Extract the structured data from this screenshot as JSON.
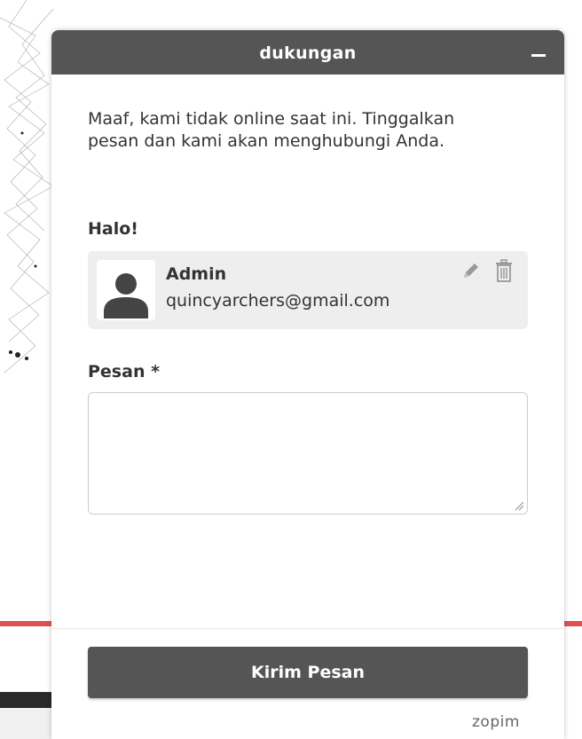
{
  "header": {
    "title": "dukungan",
    "minimize_icon": "minus-icon"
  },
  "offline_message": "Maaf, kami tidak online saat ini. Tinggalkan pesan dan kami akan menghubungi Anda.",
  "greeting": "Halo!",
  "profile": {
    "name": "Admin",
    "email": "quincyarchers@gmail.com",
    "avatar_icon": "user-avatar-icon",
    "edit_icon": "pencil-icon",
    "delete_icon": "trash-icon"
  },
  "message": {
    "label": "Pesan *",
    "value": "",
    "placeholder": ""
  },
  "submit": {
    "label": "Kirim Pesan"
  },
  "branding": {
    "name": "zopim"
  },
  "colors": {
    "header_bg": "#555555",
    "button_bg": "#555555",
    "card_bg": "#eeeeee",
    "text": "#333333",
    "accent_line": "#e05050"
  }
}
